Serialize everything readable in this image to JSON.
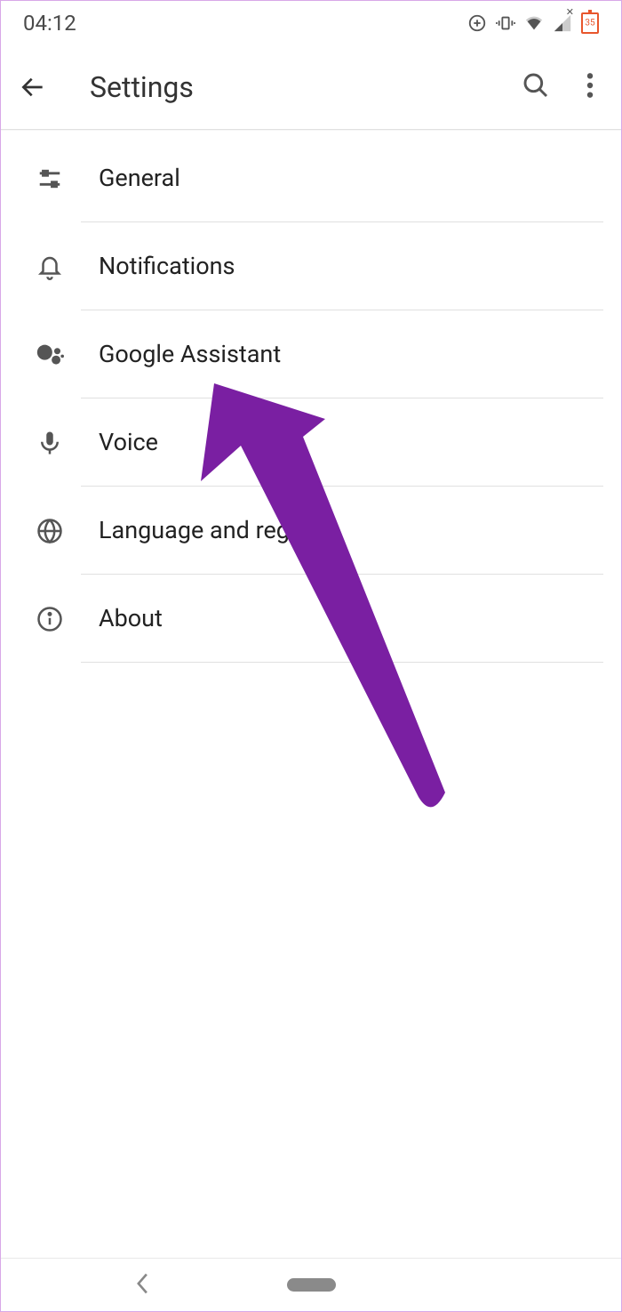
{
  "status": {
    "time": "04:12",
    "battery_value": "35"
  },
  "header": {
    "title": "Settings"
  },
  "items": [
    {
      "label": "General"
    },
    {
      "label": "Notifications"
    },
    {
      "label": "Google Assistant"
    },
    {
      "label": "Voice"
    },
    {
      "label": "Language and region"
    },
    {
      "label": "About"
    }
  ]
}
